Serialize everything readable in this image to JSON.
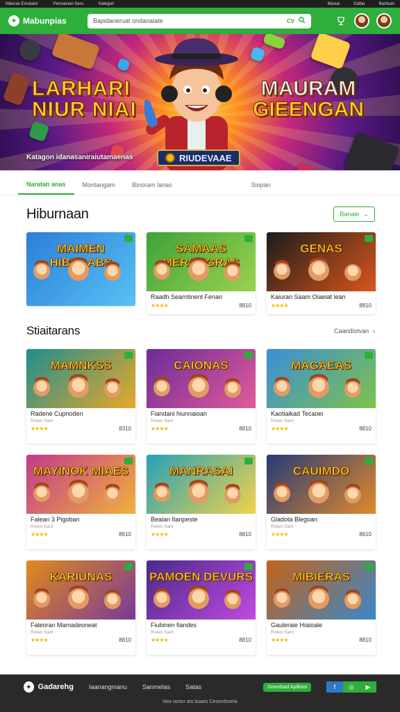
{
  "topbar": {
    "left_items": [
      "Hiburan Emulator",
      "Permainan Seru",
      "Kategori"
    ],
    "right_items": [
      "Masuk",
      "Daftar",
      "Bantuan"
    ]
  },
  "appbar": {
    "brand": "Mabunpias",
    "search_placeholder": "Bapidaneruat ondanalate",
    "search_tag": "CV",
    "icons": [
      "search-icon",
      "trophy-icon"
    ]
  },
  "hero": {
    "title_left": [
      "LARHARI",
      "NIUR NIAI"
    ],
    "title_right": [
      "MAURAM",
      "GIEENGAN"
    ],
    "caption": "Katagon idanasaniraiutamaenas",
    "button_label": "RIUDEVAAE"
  },
  "tabs": [
    "Naratan anas",
    "Montangam",
    "Binoram lanas",
    "Siopan"
  ],
  "section1": {
    "title": "Hiburnaan",
    "filter_label": "Banale"
  },
  "section2": {
    "title": "Stiaitarans",
    "view_all": "Caandistvan"
  },
  "cards_row1": [
    {
      "name": "",
      "title_art": "MAIMEN HIBUDABS",
      "sub": "",
      "price": "",
      "stars": "",
      "palette": "blue"
    },
    {
      "name": "Raadh Searntinent Fenan",
      "title_art": "SAMAAS MERANGRAS",
      "sub": "",
      "price": "8810",
      "stars": "★★★★",
      "palette": "green"
    },
    {
      "name": "Kaiuran Saam Oiaeiat lean",
      "title_art": "GENAS",
      "sub": "",
      "price": "8810",
      "stars": "★★★★",
      "palette": "dark"
    }
  ],
  "cards_row2": [
    {
      "name": "Radene Cupnoden",
      "title_art": "MAMNKSS",
      "sub": "Roten Sant",
      "price": "8310",
      "stars": "★★★★",
      "palette": "teal"
    },
    {
      "name": "Fiandani hiunnaioan",
      "title_art": "CAIONAS",
      "sub": "Roten Sant",
      "price": "8810",
      "stars": "★★★★",
      "palette": "purple"
    },
    {
      "name": "Kaotiaikad Tecaoei",
      "title_art": "MAGAEAS",
      "sub": "Roten Sant",
      "price": "8810",
      "stars": "★★★★",
      "palette": "sky"
    }
  ],
  "cards_row3": [
    {
      "name": "Falean 3 Pigoban",
      "title_art": "MAYINOK MIAES",
      "sub": "Roten Sant",
      "price": "8610",
      "stars": "★★★★",
      "palette": "pink"
    },
    {
      "name": "Bealan Itanpeste",
      "title_art": "MANRASAI",
      "sub": "Roten Sant",
      "price": "8810",
      "stars": "★★★★",
      "palette": "cyan"
    },
    {
      "name": "Gladota Blegoan",
      "title_art": "CAUIMDO",
      "sub": "Roten Sant",
      "price": "8810",
      "stars": "★★★★",
      "palette": "navy"
    }
  ],
  "cards_row4": [
    {
      "name": "Faleoran Mamadeoneat",
      "title_art": "KARIUNAS",
      "sub": "Roten Sant",
      "price": "8810",
      "stars": "★★★★",
      "palette": "gold"
    },
    {
      "name": "Fiubinen fiandes",
      "title_art": "PAMOEN DEVURS",
      "sub": "Roten Sant",
      "price": "8810",
      "stars": "★★★★",
      "palette": "violet"
    },
    {
      "name": "Gauleraie Hiaioale",
      "title_art": "MIBIERAS",
      "sub": "Roten Sant",
      "price": "8810",
      "stars": "★★★★",
      "palette": "amber"
    }
  ],
  "footer": {
    "brand": "Gadarehg",
    "links": [
      "Iaanangmanu",
      "Sanmelas",
      "Satas"
    ],
    "cta": "Download Aplikasi",
    "socials": [
      "facebook-icon",
      "instagram-icon",
      "youtube-icon"
    ],
    "copyright": "Nea Iantor atu buaes Cesendsvela"
  },
  "colors": {
    "brand_green": "#2eae3a",
    "footer_bg": "#2a2a2a",
    "star": "#f2b705"
  }
}
